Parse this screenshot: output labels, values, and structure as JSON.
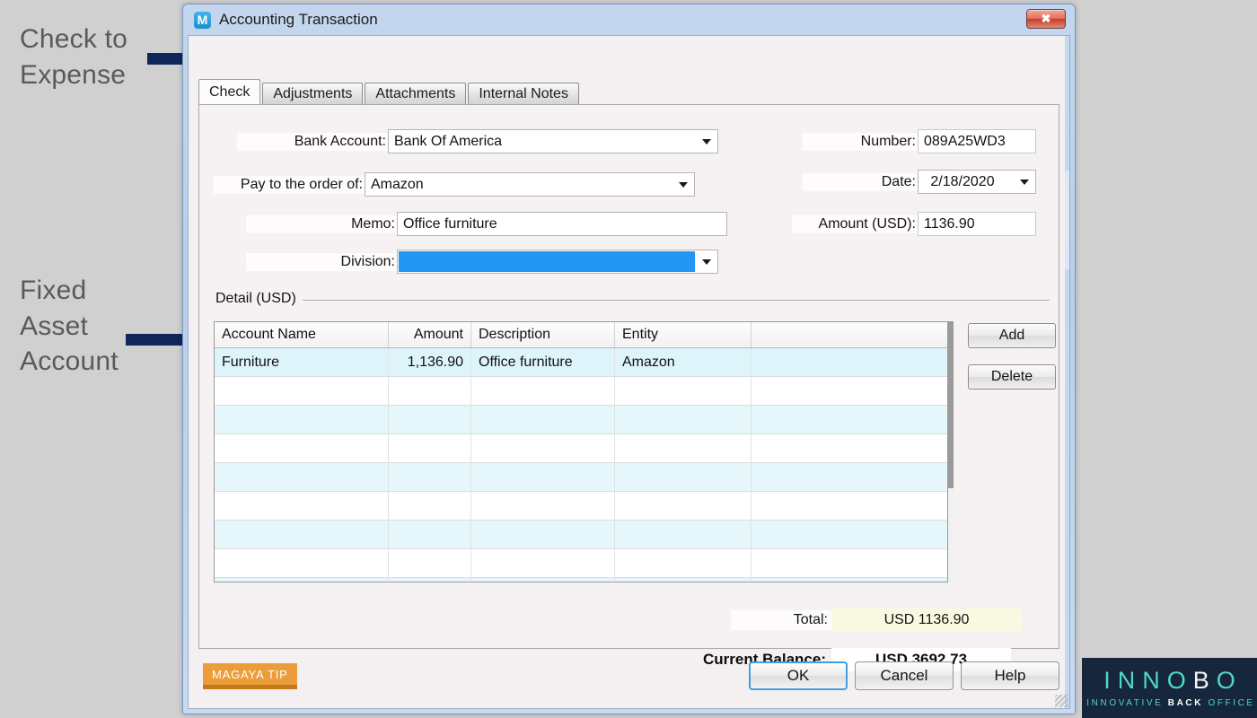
{
  "annotations": [
    {
      "id": "check-to-expense",
      "text": "Check to\nExpense"
    },
    {
      "id": "fixed-asset",
      "text": "Fixed\nAsset\nAccount"
    }
  ],
  "window": {
    "title": "Accounting Transaction",
    "icon": "M",
    "close_label": "✖"
  },
  "tabs": [
    {
      "label": "Check",
      "active": true
    },
    {
      "label": "Adjustments",
      "active": false
    },
    {
      "label": "Attachments",
      "active": false
    },
    {
      "label": "Internal Notes",
      "active": false
    }
  ],
  "form": {
    "bank_account": {
      "label": "Bank Account:",
      "value": "Bank Of America"
    },
    "pay_to_order": {
      "label": "Pay to the order of:",
      "value": "Amazon"
    },
    "memo": {
      "label": "Memo:",
      "value": "Office furniture"
    },
    "division": {
      "label": "Division:",
      "value": ""
    },
    "number": {
      "label": "Number:",
      "value": "089A25WD3"
    },
    "date": {
      "label": "Date:",
      "value": "2/18/2020"
    },
    "amount": {
      "label": "Amount (USD):",
      "value": "1136.90"
    }
  },
  "detail": {
    "group_label": "Detail (USD)",
    "columns": [
      "Account Name",
      "Amount",
      "Description",
      "Entity",
      ""
    ],
    "rows": [
      {
        "account_name": "Furniture",
        "amount": "1,136.90",
        "description": "Office furniture",
        "entity": "Amazon",
        "extra": ""
      },
      {
        "account_name": "",
        "amount": "",
        "description": "",
        "entity": "",
        "extra": ""
      },
      {
        "account_name": "",
        "amount": "",
        "description": "",
        "entity": "",
        "extra": ""
      },
      {
        "account_name": "",
        "amount": "",
        "description": "",
        "entity": "",
        "extra": ""
      },
      {
        "account_name": "",
        "amount": "",
        "description": "",
        "entity": "",
        "extra": ""
      },
      {
        "account_name": "",
        "amount": "",
        "description": "",
        "entity": "",
        "extra": ""
      },
      {
        "account_name": "",
        "amount": "",
        "description": "",
        "entity": "",
        "extra": ""
      },
      {
        "account_name": "",
        "amount": "",
        "description": "",
        "entity": "",
        "extra": ""
      },
      {
        "account_name": "",
        "amount": "",
        "description": "",
        "entity": "",
        "extra": ""
      }
    ],
    "add_label": "Add",
    "delete_label": "Delete"
  },
  "totals": {
    "total_label": "Total:",
    "total_value": "USD 1136.90",
    "balance_label": "Current Balance:",
    "balance_value": "USD 3692.73"
  },
  "footer": {
    "tip_label": "MAGAYA TIP",
    "ok_label": "OK",
    "cancel_label": "Cancel",
    "help_label": "Help"
  },
  "branding": {
    "name_parts": [
      {
        "ch": "I",
        "tone": "t"
      },
      {
        "ch": "N",
        "tone": "t"
      },
      {
        "ch": "N",
        "tone": "t"
      },
      {
        "ch": "O",
        "tone": "t"
      },
      {
        "ch": "B",
        "tone": "w"
      },
      {
        "ch": "O",
        "tone": "t"
      }
    ],
    "tagline_a": "INNOVATIVE ",
    "tagline_b": "BACK ",
    "tagline_c": "OFFICE"
  },
  "colors": {
    "accent_blue": "#2196f3",
    "teal": "#4fd8c6",
    "brand_dark": "#16263c",
    "tip_orange": "#ed9c3a",
    "arrow_navy": "#10275c",
    "row_alt": "#e6f7fb",
    "total_bg": "#fbf8e2"
  }
}
